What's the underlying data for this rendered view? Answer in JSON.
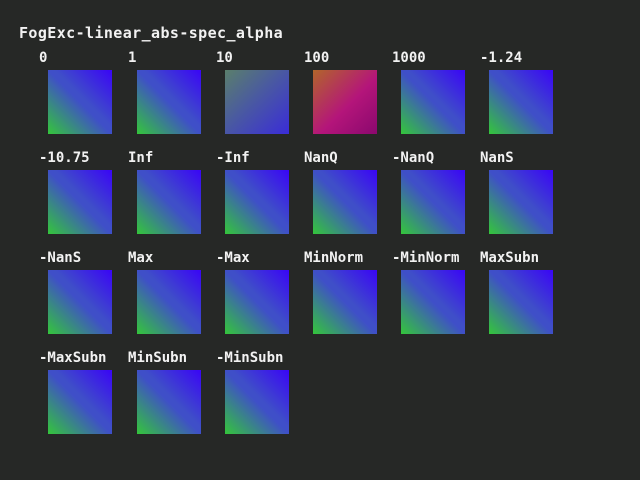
{
  "title": "FogExc-linear_abs-spec_alpha",
  "colors": {
    "background": "#262826",
    "text": "#f2f2f2",
    "swatch_green": "#34c63a",
    "swatch_blue": "#3f4fc8",
    "swatch_violet": "#3a05f6",
    "swatch_orange": "#b2652a",
    "swatch_magenta": "#b4157a",
    "swatch_pink": "#8a086e"
  },
  "cells": [
    {
      "label": "0",
      "variant": "normal"
    },
    {
      "label": "1",
      "variant": "normal"
    },
    {
      "label": "10",
      "variant": "dim"
    },
    {
      "label": "100",
      "variant": "red"
    },
    {
      "label": "1000",
      "variant": "normal"
    },
    {
      "label": "-1.24",
      "variant": "normal"
    },
    {
      "label": "-10.75",
      "variant": "normal"
    },
    {
      "label": "Inf",
      "variant": "normal"
    },
    {
      "label": "-Inf",
      "variant": "normal"
    },
    {
      "label": "NanQ",
      "variant": "normal"
    },
    {
      "label": "-NanQ",
      "variant": "normal"
    },
    {
      "label": "NanS",
      "variant": "normal"
    },
    {
      "label": "-NanS",
      "variant": "normal"
    },
    {
      "label": "Max",
      "variant": "normal"
    },
    {
      "label": "-Max",
      "variant": "normal"
    },
    {
      "label": "MinNorm",
      "variant": "normal"
    },
    {
      "label": "-MinNorm",
      "variant": "normal"
    },
    {
      "label": "MaxSubn",
      "variant": "normal"
    },
    {
      "label": "-MaxSubn",
      "variant": "normal"
    },
    {
      "label": "MinSubn",
      "variant": "normal"
    },
    {
      "label": "-MinSubn",
      "variant": "normal"
    }
  ]
}
